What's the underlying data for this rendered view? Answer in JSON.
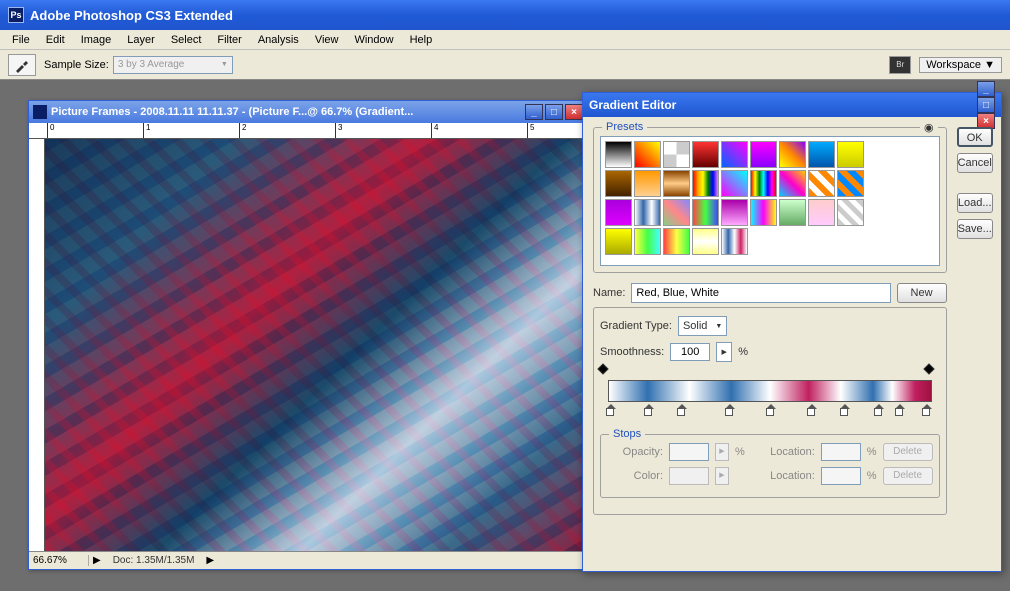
{
  "app": {
    "title": "Adobe Photoshop CS3 Extended",
    "icon": "Ps"
  },
  "menu": [
    "File",
    "Edit",
    "Image",
    "Layer",
    "Select",
    "Filter",
    "Analysis",
    "View",
    "Window",
    "Help"
  ],
  "options": {
    "sample_label": "Sample Size:",
    "sample_value": "3 by 3 Average",
    "workspace": "Workspace ▼",
    "br": "Br"
  },
  "doc": {
    "title": "Picture Frames - 2008.11.11 11.11.37 - (Picture F...@ 66.7% (Gradient...",
    "zoom": "66.67%",
    "info": "Doc: 1.35M/1.35M",
    "ruler_ticks": [
      "0",
      "1",
      "2",
      "3",
      "4",
      "5"
    ]
  },
  "grad": {
    "title": "Gradient Editor",
    "presets_label": "Presets",
    "name_label": "Name:",
    "name_value": "Red, Blue, White",
    "new_btn": "New",
    "type_label": "Gradient Type:",
    "type_value": "Solid",
    "smooth_label": "Smoothness:",
    "smooth_value": "100",
    "pct": "%",
    "stops_label": "Stops",
    "opacity_label": "Opacity:",
    "color_label": "Color:",
    "location_label": "Location:",
    "delete": "Delete",
    "buttons": {
      "ok": "OK",
      "cancel": "Cancel",
      "load": "Load...",
      "save": "Save..."
    },
    "preset_colors": [
      "linear-gradient(#000,#fff)",
      "linear-gradient(45deg,red,yellow)",
      "repeating-conic-gradient(#ccc 0 25%,#fff 0 50%)",
      "linear-gradient(#f33,#600)",
      "linear-gradient(45deg,#06f,#f0f)",
      "linear-gradient(#f0f,#80f)",
      "linear-gradient(45deg,#ff0,#f80,#80f)",
      "linear-gradient(#0af,#05a)",
      "linear-gradient(#ff0,#cc0)",
      "linear-gradient(#a60,#420)",
      "linear-gradient(#f90,#ffd090)",
      "linear-gradient(#840,#fc8,#840)",
      "linear-gradient(90deg,red,orange,yellow,green,blue,violet)",
      "linear-gradient(45deg,#f0f,#0ff)",
      "linear-gradient(90deg,red,yellow,green,cyan,blue,magenta,red)",
      "linear-gradient(45deg,#0cf,#f0c,#fc0)",
      "repeating-linear-gradient(45deg,#f80 0 6px,#fff 6px 12px)",
      "repeating-linear-gradient(45deg,#08f 0 6px,#f80 6px 12px)",
      "linear-gradient(#a0d,#d0f)",
      "linear-gradient(90deg,#fff,#36a,#fff,#36a)",
      "linear-gradient(45deg,#8c8,#f88,#88f)",
      "linear-gradient(90deg,#f44,#4f4,#44f)",
      "linear-gradient(#a0a,#faf)",
      "linear-gradient(90deg,#0ff,#f0f,#ff0)",
      "linear-gradient(#cfc,#6a6)",
      "linear-gradient(#fcc,#fcf)",
      "repeating-linear-gradient(45deg,#ccc 0 5px,#fff 5px 10px)",
      "linear-gradient(#ff0,#aa0)",
      "linear-gradient(90deg,#ff4,#4f4,#4ff)",
      "linear-gradient(90deg,#f44,#ff4,#4f4)",
      "linear-gradient(#ff8,#fff,#ff8)",
      "linear-gradient(90deg,#fff,#36a,#fff,#c26,#fff)"
    ],
    "color_stops_pct": [
      3,
      14,
      24,
      38,
      50,
      62,
      72,
      82,
      88,
      96
    ],
    "opacity_stops_pct": [
      1,
      97
    ]
  }
}
